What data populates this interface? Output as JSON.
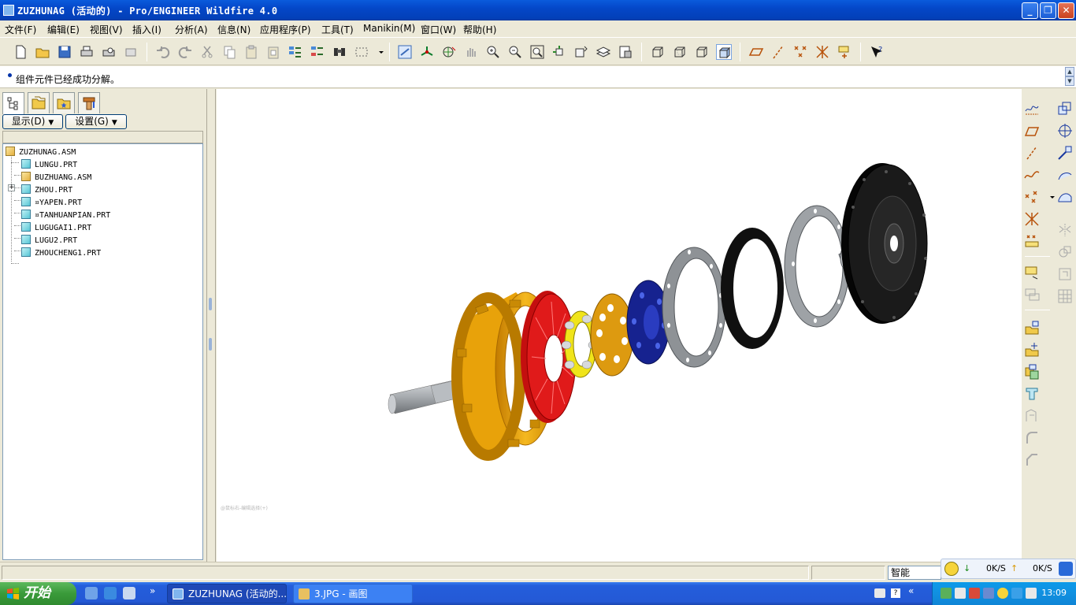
{
  "window": {
    "title": "ZUZHUNAG (活动的) - Pro/ENGINEER Wildfire 4.0",
    "controls": {
      "minimize": "_",
      "maximize": "❐",
      "close": "✕"
    }
  },
  "menubar": {
    "items": [
      {
        "label": "文件(F)"
      },
      {
        "label": "编辑(E)"
      },
      {
        "label": "视图(V)"
      },
      {
        "label": "插入(I)"
      },
      {
        "label": "分析(A)"
      },
      {
        "label": "信息(N)"
      },
      {
        "label": "应用程序(P)"
      },
      {
        "label": "工具(T)"
      },
      {
        "label": "Manikin(M)"
      },
      {
        "label": "窗口(W)"
      },
      {
        "label": "帮助(H)"
      }
    ]
  },
  "toolbar": {
    "icons": [
      "new-file-icon",
      "open-file-icon",
      "save-icon",
      "print-icon",
      "print-preview-icon",
      "erase-icon",
      "undo-icon",
      "redo-icon",
      "cut-icon",
      "copy-icon",
      "paste-icon",
      "paste-special-icon",
      "regenerate-icon",
      "regen-manager-icon",
      "find-icon",
      "select-box-icon",
      "redraw-icon",
      "spin-center-icon",
      "orient-mode-icon",
      "pan-icon",
      "zoom-in-icon",
      "zoom-out-icon",
      "refit-icon",
      "reorient-icon",
      "saved-views-icon",
      "layers-icon",
      "view-manager-icon",
      "wireframe-icon",
      "hidden-line-icon",
      "no-hidden-icon",
      "shading-icon",
      "datum-planes-icon",
      "datum-axes-icon",
      "datum-points-icon",
      "csys-icon",
      "annotations-icon",
      "context-help-icon"
    ]
  },
  "message": {
    "text": "组件元件已经成功分解。"
  },
  "model_tree": {
    "tabs": [
      "model-tree-tab",
      "folder-browser-tab",
      "favorites-tab",
      "connections-tab"
    ],
    "show_button": "显示(D)",
    "settings_button": "设置(G)",
    "nodes": [
      {
        "label": "ZUZHUNAG.ASM",
        "type": "asm",
        "level": 0
      },
      {
        "label": "LUNGU.PRT",
        "type": "prt",
        "level": 1
      },
      {
        "label": "BUZHUANG.ASM",
        "type": "asm",
        "level": 1,
        "expandable": true
      },
      {
        "label": "ZHOU.PRT",
        "type": "prt",
        "level": 1
      },
      {
        "label": "¤YAPEN.PRT",
        "type": "prt",
        "level": 1
      },
      {
        "label": "¤TANHUANPIAN.PRT",
        "type": "prt",
        "level": 1
      },
      {
        "label": "LUGUGAI1.PRT",
        "type": "prt",
        "level": 1
      },
      {
        "label": "LUGU2.PRT",
        "type": "prt",
        "level": 1
      },
      {
        "label": "ZHOUCHENG1.PRT",
        "type": "prt",
        "level": 1
      }
    ]
  },
  "graphics": {
    "hint": "@鼠标右-编辑选择(+)",
    "colors": {
      "hub": "#e8a20a",
      "red_disc": "#d81414",
      "yellow_ring": "#f0e41a",
      "orange_disc": "#dd9a10",
      "blue_disc": "#16228f",
      "gray_ring": "#9ea2a6",
      "black_ring": "#101010",
      "flywheel": "#0b0b0b",
      "shaft": "#a9adb1"
    }
  },
  "right_toolbar": {
    "icons": [
      "sketch-tool-icon",
      "scale-model-icon",
      "datum-plane-icon",
      "axis-icon",
      "datum-axis-icon",
      "csys-tool-icon",
      "curve-icon",
      "analysis-feature-icon",
      "point-icon",
      "surface-icon",
      "point-offset-icon",
      "boundary-icon",
      "point-field-icon",
      "mirror-icon",
      "merge-icon",
      "trim-icon",
      "pattern-icon",
      "intersect-icon",
      "assemble-icon",
      "create-component-icon",
      "package-icon",
      "cut-out-icon",
      "shrink-wrap-icon",
      "round-icon",
      "chamfer-icon"
    ]
  },
  "statusbar": {
    "filter": "智能"
  },
  "netmeter": {
    "down": "0K/S",
    "up": "0K/S"
  },
  "taskbar": {
    "start": "开始",
    "quicklaunch_more": "»",
    "tasks": [
      {
        "label": "ZUZHUNAG (活动的..."
      },
      {
        "label": "3.JPG - 画图"
      }
    ],
    "tray_more": "«",
    "clock": "13:09"
  }
}
